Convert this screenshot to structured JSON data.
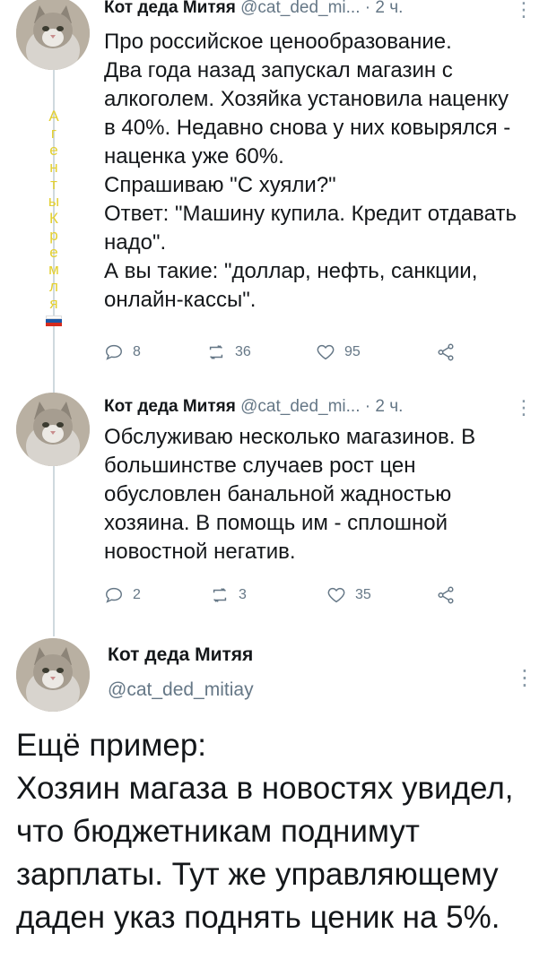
{
  "tweets": [
    {
      "name": "Кот деда Митяя",
      "handle": "@cat_ded_mi...",
      "time": "· 2 ч.",
      "text": "Про российское ценообразование.\nДва года назад запускал магазин с алкоголем. Хозяйка установила наценку в 40%. Недавно снова у них ковырялся - наценка уже 60%.\nСпрашиваю \"С хуяли?\"\nОтвет: \"Машину купила. Кредит отдавать надо\".\nА вы такие: \"доллар, нефть, санкции, онлайн-кассы\".",
      "replies": "8",
      "retweets": "36",
      "likes": "95"
    },
    {
      "name": "Кот деда Митяя",
      "handle": "@cat_ded_mi...",
      "time": "· 2 ч.",
      "text": "Обслуживаю несколько магазинов. В большинстве случаев рост цен обусловлен банальной жадностью хозяина. В помощь им - сплошной новостной негатив.",
      "replies": "2",
      "retweets": "3",
      "likes": "35"
    }
  ],
  "main_tweet": {
    "name": "Кот деда Митяя",
    "handle": "@cat_ded_mitiay",
    "text": "Ещё пример:\nХозяин магаза в новостях увидел, что бюджетникам поднимут зарплаты. Тут же управляющему даден указ поднять ценик на 5%."
  },
  "watermark": {
    "letters": [
      "А",
      "г",
      "е",
      "н",
      "т",
      "ы",
      "К",
      "р",
      "е",
      "м",
      "л",
      "я"
    ],
    "color": "#e3cf2f",
    "flag_colors": [
      "#ffffff",
      "#1c57a5",
      "#d52b1e"
    ]
  },
  "icons": {
    "reply": "reply-icon",
    "retweet": "retweet-icon",
    "like": "heart-icon",
    "share": "share-icon",
    "more": "more-vertical-icon"
  },
  "colors": {
    "text": "#14171a",
    "secondary": "#657786",
    "thread_line": "#cfd9de"
  }
}
